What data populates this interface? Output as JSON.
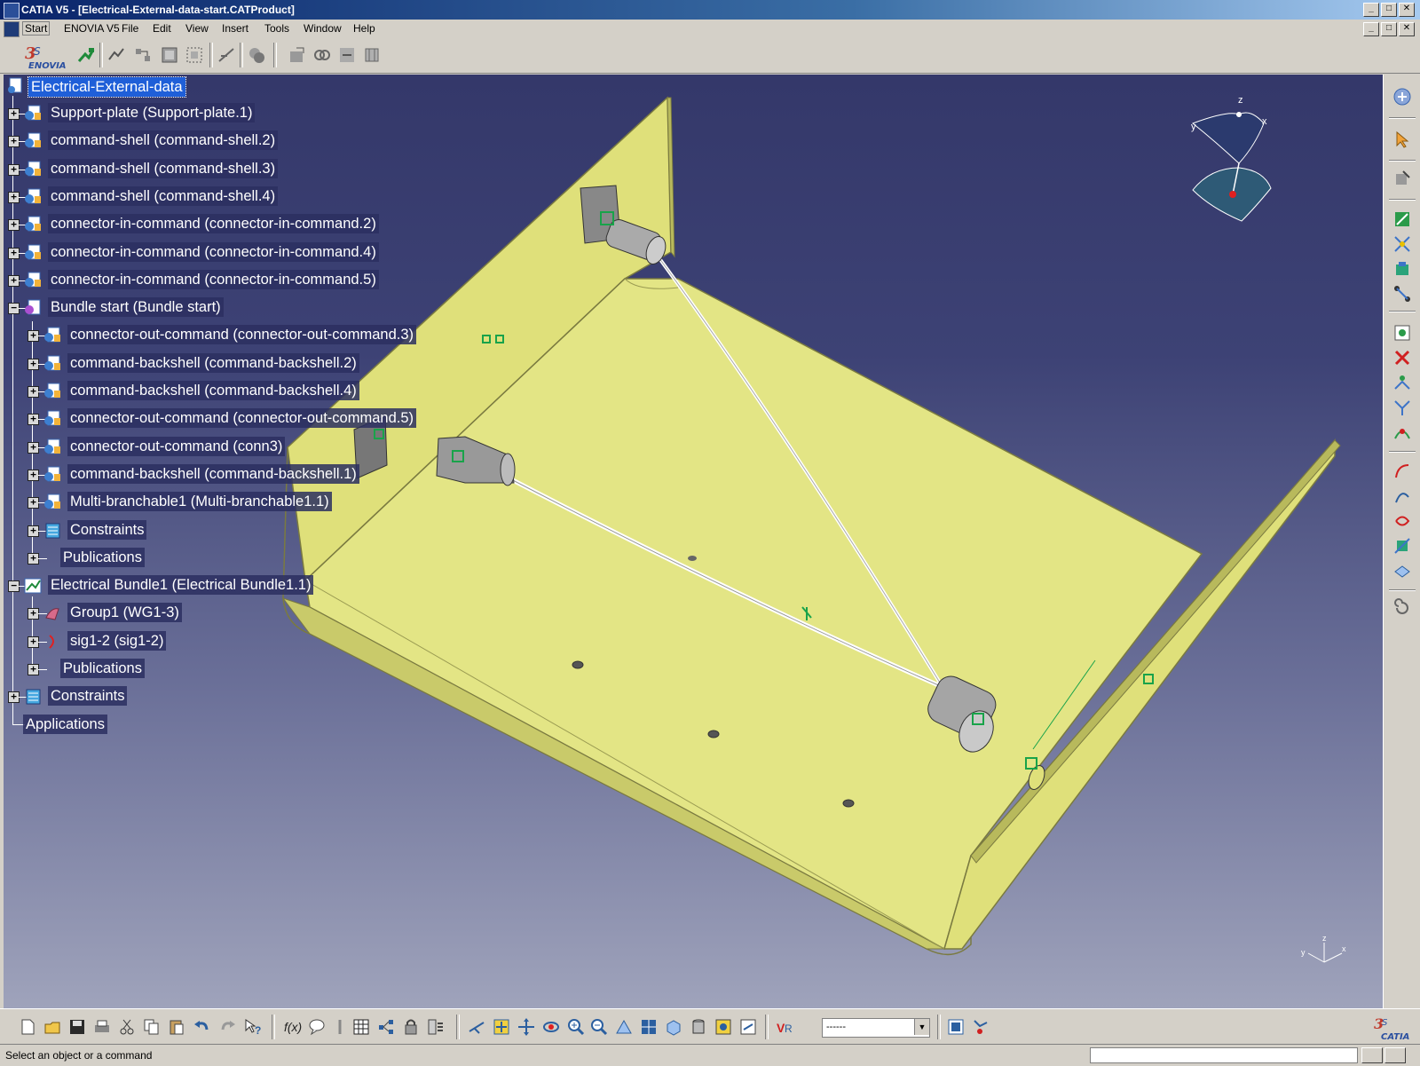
{
  "window": {
    "title": "CATIA V5 - [Electrical-External-data-start.CATProduct]",
    "controls": [
      "_",
      "□",
      "✕"
    ]
  },
  "menu": {
    "items": [
      "Start",
      "ENOVIA V5",
      "File",
      "Edit",
      "View",
      "Insert",
      "Tools",
      "Window",
      "Help"
    ]
  },
  "tree": {
    "root": "Electrical-External-data",
    "items": [
      {
        "label": "Support-plate (Support-plate.1)",
        "expander": "+"
      },
      {
        "label": "command-shell (command-shell.2)",
        "expander": "+"
      },
      {
        "label": "command-shell (command-shell.3)",
        "expander": "+"
      },
      {
        "label": "command-shell (command-shell.4)",
        "expander": "+"
      },
      {
        "label": "connector-in-command (connector-in-command.2)",
        "expander": "+"
      },
      {
        "label": "connector-in-command (connector-in-command.4)",
        "expander": "+"
      },
      {
        "label": "connector-in-command (connector-in-command.5)",
        "expander": "+"
      },
      {
        "label": "Bundle start (Bundle start)",
        "expander": "−"
      },
      {
        "label": "connector-out-command (connector-out-command.3)",
        "expander": "+"
      },
      {
        "label": "command-backshell (command-backshell.2)",
        "expander": "+"
      },
      {
        "label": "command-backshell (command-backshell.4)",
        "expander": "+"
      },
      {
        "label": "connector-out-command (connector-out-command.5)",
        "expander": "+"
      },
      {
        "label": "connector-out-command (conn3)",
        "expander": "+"
      },
      {
        "label": "command-backshell (command-backshell.1)",
        "expander": "+"
      },
      {
        "label": "Multi-branchable1 (Multi-branchable1.1)",
        "expander": "+"
      },
      {
        "label": "Constraints",
        "expander": "+"
      },
      {
        "label": "Publications",
        "expander": "+"
      },
      {
        "label": "Electrical Bundle1 (Electrical Bundle1.1)",
        "expander": "−"
      },
      {
        "label": "Group1 (WG1-3)",
        "expander": "+"
      },
      {
        "label": "sig1-2 (sig1-2)",
        "expander": "+"
      },
      {
        "label": "Publications",
        "expander": "+"
      },
      {
        "label": "Constraints",
        "expander": "+"
      },
      {
        "label": "Applications",
        "expander": ""
      }
    ]
  },
  "compass": {
    "z": "z",
    "x": "x",
    "y": "y"
  },
  "combo": {
    "value": "------"
  },
  "status": {
    "text": "Select an object or a command"
  },
  "colors": {
    "plate": "#dfe07a",
    "plate_edge": "#b8b95c",
    "viewport_top": "#34386a",
    "viewport_bottom": "#9fa3bb",
    "selection": "#1f5fd8"
  }
}
